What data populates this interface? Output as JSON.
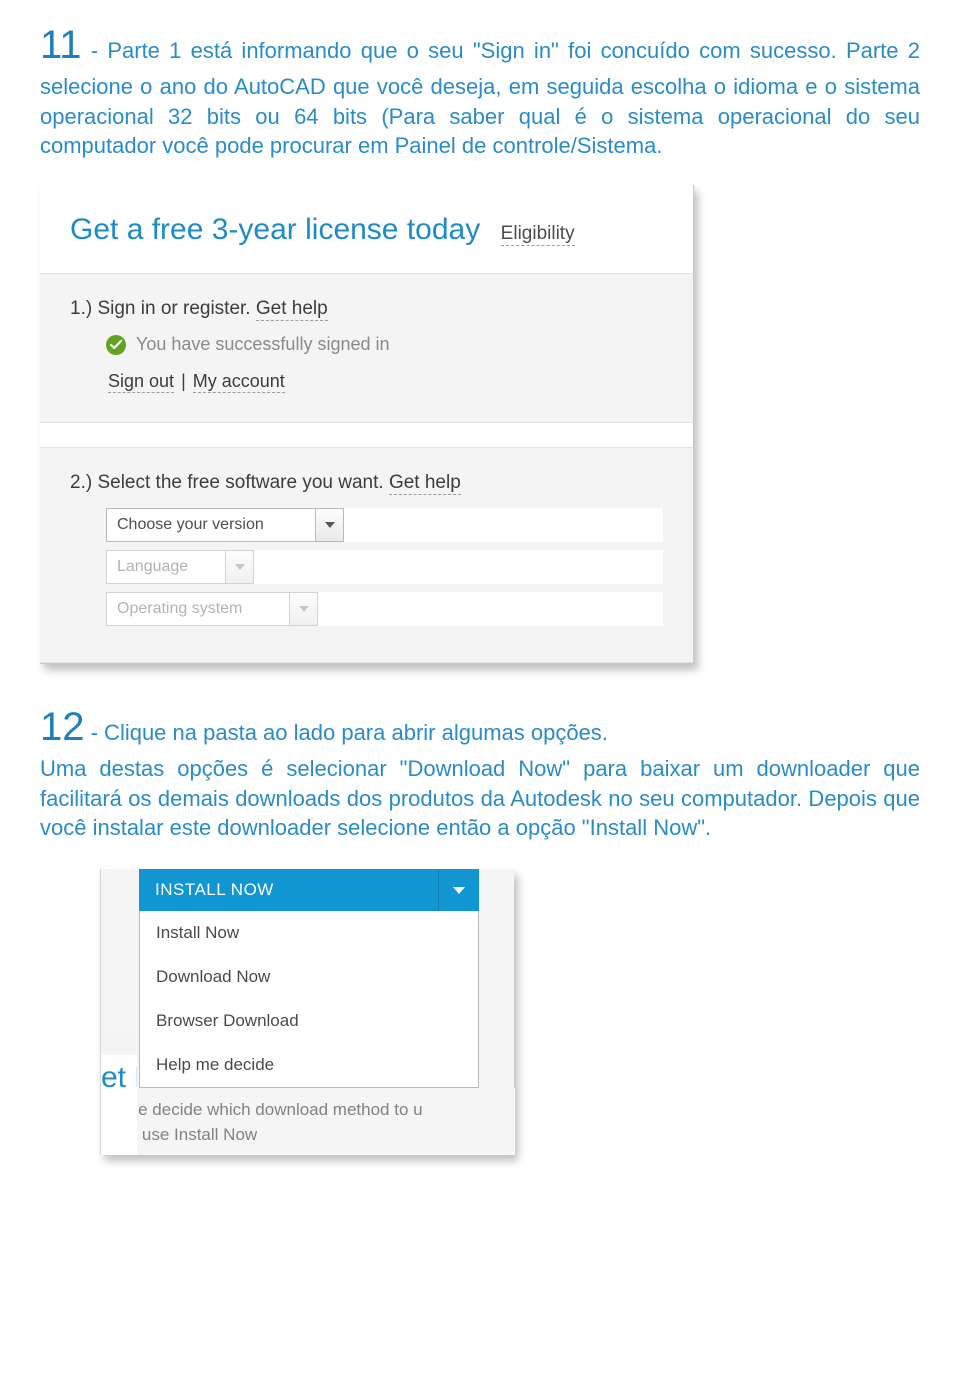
{
  "step11": {
    "num": "11",
    "text": " - Parte 1 está informando que o seu \"Sign in\" foi concuído com sucesso. Parte 2 selecione o ano do AutoCAD que você deseja, em seguida escolha o idioma e o sistema operacional 32 bits ou 64 bits (Para saber qual é o sistema operacional do seu computador você pode procurar em Painel de controle/Sistema."
  },
  "ss1": {
    "title": "Get a free 3-year license today",
    "eligibility": "Eligibility",
    "step1": {
      "prefix": "1.)  Sign in or register. ",
      "help": "Get help"
    },
    "success": "You have successfully signed in",
    "signout": "Sign out",
    "myaccount": "My account",
    "sep": " | ",
    "step2": {
      "prefix": "2.)  Select the free software you want. ",
      "help": "Get help"
    },
    "dd_version": "Choose your version",
    "dd_language": "Language",
    "dd_os": "Operating system"
  },
  "step12": {
    "num": "12",
    "lead": " - Clique na pasta ao lado para abrir algumas opções.",
    "rest": "Uma destas opções é selecionar \"Download Now\" para baixar um downloader que facilitará os demais downloads dos produtos da Autodesk no seu computador. Depois que você instalar este downloader selecione então a opção \"Install Now\"."
  },
  "ss2": {
    "button": "INSTALL NOW",
    "menu": [
      "Install Now",
      "Download Now",
      "Browser Download",
      "Help me decide"
    ],
    "frag_title": "et H",
    "bottom_l1": "lp me decide which download method to u",
    "bottom_l2": "w to use Install Now"
  }
}
